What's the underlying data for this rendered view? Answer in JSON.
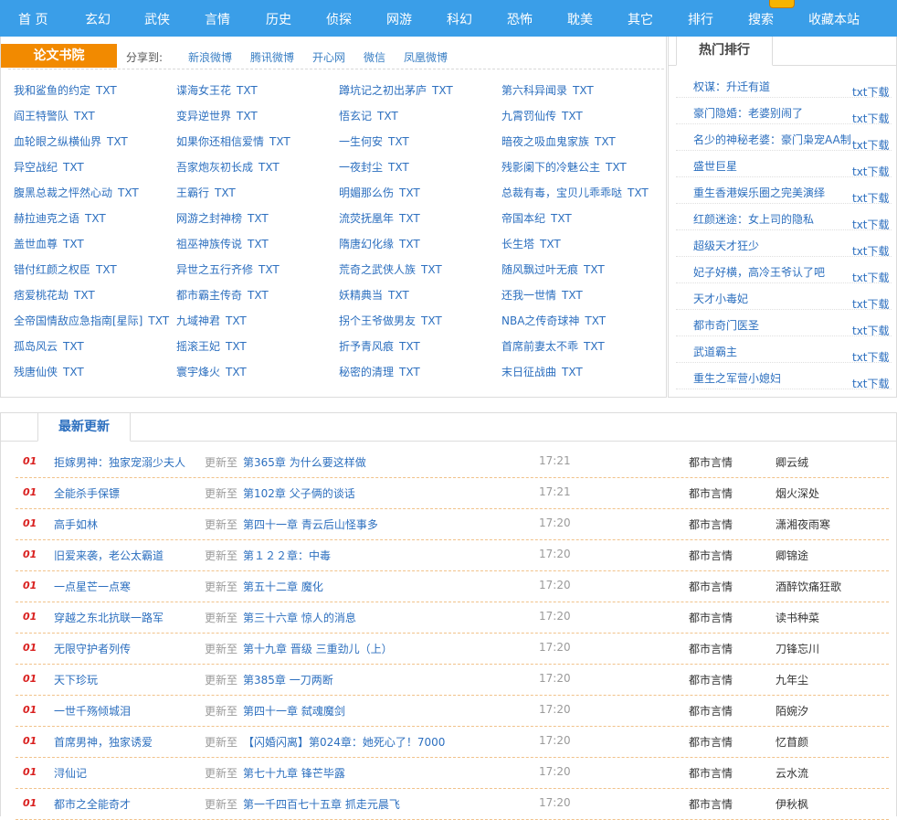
{
  "nav": [
    "首 页",
    "玄幻",
    "武侠",
    "言情",
    "历史",
    "侦探",
    "网游",
    "科幻",
    "恐怖",
    "耽美",
    "其它",
    "排行",
    "搜索",
    "收藏本站"
  ],
  "panel": {
    "tag": "论文书院",
    "share_label": "分享到:",
    "shares": [
      "新浪微博",
      "腾讯微博",
      "开心网",
      "微信",
      "凤凰微博"
    ]
  },
  "books": [
    [
      "我和鲨鱼的约定",
      "谍海女王花",
      "蹲坑记之初出茅庐",
      "第六科异闻录"
    ],
    [
      "阎王特警队",
      "变异逆世界",
      "悟玄记",
      "九霄罚仙传"
    ],
    [
      "血轮眼之纵横仙界",
      "如果你还相信爱情",
      "一生何安",
      "暗夜之吸血鬼家族"
    ],
    [
      "异空战纪",
      "吾家炮灰初长成",
      "一夜封尘",
      "残影阑下的冷魅公主"
    ],
    [
      "腹黑总裁之怦然心动",
      "王霸行",
      "明媚那么伤",
      "总裁有毒，宝贝儿乖乖哒"
    ],
    [
      "赫拉迪克之语",
      "网游之封神榜",
      "流荧抚凰年",
      "帝国本纪"
    ],
    [
      "盖世血尊",
      "祖巫神族传说",
      "隋唐幻化缘",
      "长生塔"
    ],
    [
      "错付红颜之权臣",
      "异世之五行齐修",
      "荒奇之武侠人族",
      "随风飘过叶无痕"
    ],
    [
      "痞爱桃花劫",
      "都市霸主传奇",
      "妖精典当",
      "还我一世情"
    ],
    [
      "全帝国情敌应急指南[星际]",
      "九域神君",
      "拐个王爷做男友",
      "NBA之传奇球神"
    ],
    [
      "孤岛风云",
      "摇滚王妃",
      "折予青风痕",
      "首席前妻太不乖"
    ],
    [
      "残唐仙侠",
      "寰宇烽火",
      "秘密的清理",
      "末日征战曲"
    ]
  ],
  "txt_label": "TXT",
  "hot": {
    "title": "热门排行",
    "dl_label": "txt下载",
    "items": [
      "权谋：升迁有道",
      "豪门隐婚：老婆别闹了",
      "名少的神秘老婆：豪门枭宠AA制",
      "盛世巨星",
      "重生香港娱乐圈之完美演绎",
      "红颜迷途：女上司的隐私",
      "超级天才狂少",
      "妃子好横，高冷王爷认了吧",
      "天才小毒妃",
      "都市奇门医圣",
      "武道霸主",
      "重生之军营小媳妇"
    ]
  },
  "latest": {
    "title": "最新更新",
    "update_label": "更新至",
    "rows": [
      {
        "num": "01",
        "book": "拒嫁男神：独家宠溺少夫人",
        "chapter": "第365章 为什么要这样做",
        "time": "17:21",
        "category": "都市言情",
        "author": "卿云绒"
      },
      {
        "num": "01",
        "book": "全能杀手保镖",
        "chapter": "第102章 父子俩的谈话",
        "time": "17:21",
        "category": "都市言情",
        "author": "烟火深处"
      },
      {
        "num": "01",
        "book": "高手如林",
        "chapter": "第四十一章 青云后山怪事多",
        "time": "17:20",
        "category": "都市言情",
        "author": "潇湘夜雨寒"
      },
      {
        "num": "01",
        "book": "旧爱来袭，老公太霸道",
        "chapter": "第１２２章：中毒",
        "time": "17:20",
        "category": "都市言情",
        "author": "卿锦途"
      },
      {
        "num": "01",
        "book": "一点星芒一点寒",
        "chapter": "第五十二章 魔化",
        "time": "17:20",
        "category": "都市言情",
        "author": "酒醉饮痛狂歌"
      },
      {
        "num": "01",
        "book": "穿越之东北抗联一路军",
        "chapter": "第三十六章 惊人的消息",
        "time": "17:20",
        "category": "都市言情",
        "author": "读书种菜"
      },
      {
        "num": "01",
        "book": "无限守护者列传",
        "chapter": "第十九章 晋级 三重劲儿（上）",
        "time": "17:20",
        "category": "都市言情",
        "author": "刀锋忘川"
      },
      {
        "num": "01",
        "book": "天下珍玩",
        "chapter": "第385章 一刀两断",
        "time": "17:20",
        "category": "都市言情",
        "author": "九年尘"
      },
      {
        "num": "01",
        "book": "一世千殇倾城泪",
        "chapter": "第四十一章 弑魂魔剑",
        "time": "17:20",
        "category": "都市言情",
        "author": "陌婉汐"
      },
      {
        "num": "01",
        "book": "首席男神，独家诱爱",
        "chapter": "【闪婚闪离】第024章：她死心了！7000",
        "time": "17:20",
        "category": "都市言情",
        "author": "忆苜颜"
      },
      {
        "num": "01",
        "book": "浔仙记",
        "chapter": "第七十九章 锋芒毕露",
        "time": "17:20",
        "category": "都市言情",
        "author": "云水流"
      },
      {
        "num": "01",
        "book": "都市之全能奇才",
        "chapter": "第一千四百七十五章 抓走元晨飞",
        "time": "17:20",
        "category": "都市言情",
        "author": "伊秋枫"
      }
    ]
  },
  "colors": {
    "nav_bg": "#3a9ee8",
    "tag_bg": "#f28a00",
    "link": "#2c6fbf",
    "rank_num": "#d9201f"
  }
}
